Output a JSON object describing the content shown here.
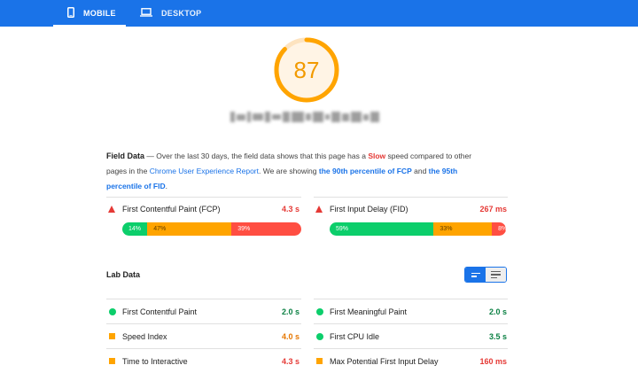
{
  "tabs": [
    {
      "label": "MOBILE",
      "icon": "phone-icon",
      "active": true
    },
    {
      "label": "DESKTOP",
      "icon": "laptop-icon",
      "active": false
    }
  ],
  "score": {
    "value": "87",
    "fraction": 0.87,
    "color": "#f29a00"
  },
  "field_data": {
    "heading": "Field Data",
    "text_1": " — Over the last 30 days, the field data shows that this page has a ",
    "slow": "Slow",
    "text_2": " speed compared to other pages in the ",
    "report_link": "Chrome User Experience Report",
    "text_3": ". We are showing ",
    "fcp_link": "the 90th percentile of FCP",
    "text_4": " and ",
    "fid_link": "the 95th percentile of FID",
    "text_5": ".",
    "metrics": [
      {
        "name": "First Contentful Paint (FCP)",
        "value": "4.3 s",
        "distribution": [
          {
            "label": "14%",
            "pct": 14
          },
          {
            "label": "47%",
            "pct": 47
          },
          {
            "label": "39%",
            "pct": 39
          }
        ]
      },
      {
        "name": "First Input Delay (FID)",
        "value": "267 ms",
        "distribution": [
          {
            "label": "59%",
            "pct": 59
          },
          {
            "label": "33%",
            "pct": 33
          },
          {
            "label": "8%",
            "pct": 8
          }
        ]
      }
    ]
  },
  "lab_data": {
    "heading": "Lab Data",
    "metrics": [
      {
        "name": "First Contentful Paint",
        "value": "2.0 s",
        "status": "good"
      },
      {
        "name": "First Meaningful Paint",
        "value": "2.0 s",
        "status": "good"
      },
      {
        "name": "Speed Index",
        "value": "4.0 s",
        "status": "average"
      },
      {
        "name": "First CPU Idle",
        "value": "3.5 s",
        "status": "good"
      },
      {
        "name": "Time to Interactive",
        "value": "4.3 s",
        "status": "average"
      },
      {
        "name": "Max Potential First Input Delay",
        "value": "160 ms",
        "status": "average"
      }
    ]
  },
  "colors": {
    "brand": "#1a73e8",
    "good": "#0cce6b",
    "average": "#ffa400",
    "poor": "#ff4e42"
  }
}
